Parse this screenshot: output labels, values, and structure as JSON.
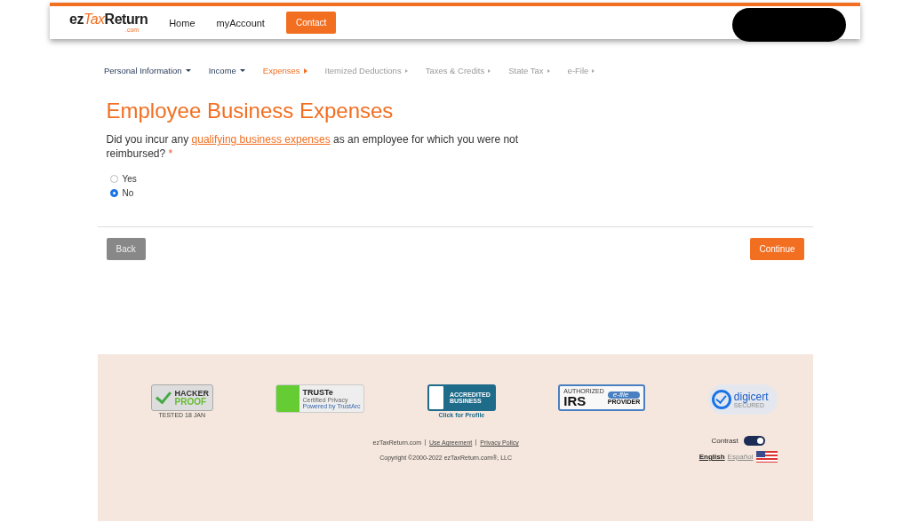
{
  "header": {
    "logo": {
      "brand_dark": "ez",
      "brand_accent": "Tax",
      "brand_end": "Return",
      "suffix": ".com"
    },
    "links": [
      {
        "label": "Home",
        "kind": "link"
      },
      {
        "label": "myAccount",
        "kind": "link"
      },
      {
        "label": "Contact",
        "kind": "button"
      }
    ],
    "redacted": true
  },
  "steps": [
    {
      "label": "Personal Information",
      "selected": false,
      "disabled": false
    },
    {
      "label": "Income",
      "selected": false,
      "disabled": false
    },
    {
      "label": "Expenses",
      "selected": true,
      "disabled": false
    },
    {
      "label": "Itemized Deductions",
      "selected": false,
      "disabled": true
    },
    {
      "label": "Taxes & Credits",
      "selected": false,
      "disabled": true
    },
    {
      "label": "State Tax",
      "selected": false,
      "disabled": true
    },
    {
      "label": "e-File",
      "selected": false,
      "disabled": true
    }
  ],
  "title": "Employee Business Expenses",
  "question": {
    "before": "Did you incur any ",
    "link": "qualifying business expenses",
    "after": " as an employee for which you were not reimbursed?",
    "required_mark": "*"
  },
  "options": [
    {
      "label": "Yes",
      "selected": false
    },
    {
      "label": "No",
      "selected": true
    }
  ],
  "buttons": {
    "back": "Back",
    "continue": "Continue"
  },
  "footer": {
    "badges": [
      {
        "kind": "hacker",
        "lines": [
          "HACKER",
          "PROOF"
        ],
        "caption": "TESTED  18 JAN"
      },
      {
        "kind": "truste",
        "lines": [
          "TRUSTe",
          "Certified Privacy",
          "Powered by TrustArc"
        ]
      },
      {
        "kind": "bbb",
        "lines": [
          "ACCREDITED",
          "BUSINESS"
        ],
        "caption": "Click for Profile"
      },
      {
        "kind": "irs",
        "lines": [
          "AUTHORIZED",
          "e-file",
          "IRS",
          "PROVIDER"
        ]
      },
      {
        "kind": "digicert",
        "lines": [
          "digicert",
          "SECURED"
        ]
      }
    ],
    "links": [
      "ezTaxReturn.com",
      "Use Agreement",
      "Privacy Policy"
    ],
    "copyright": "Copyright ©2000-2022 ezTaxReturn.com®, LLC",
    "contrast": {
      "label": "Contrast",
      "on": true
    },
    "languages": [
      {
        "label": "English",
        "selected": true
      },
      {
        "label": "Español",
        "selected": false
      }
    ]
  }
}
